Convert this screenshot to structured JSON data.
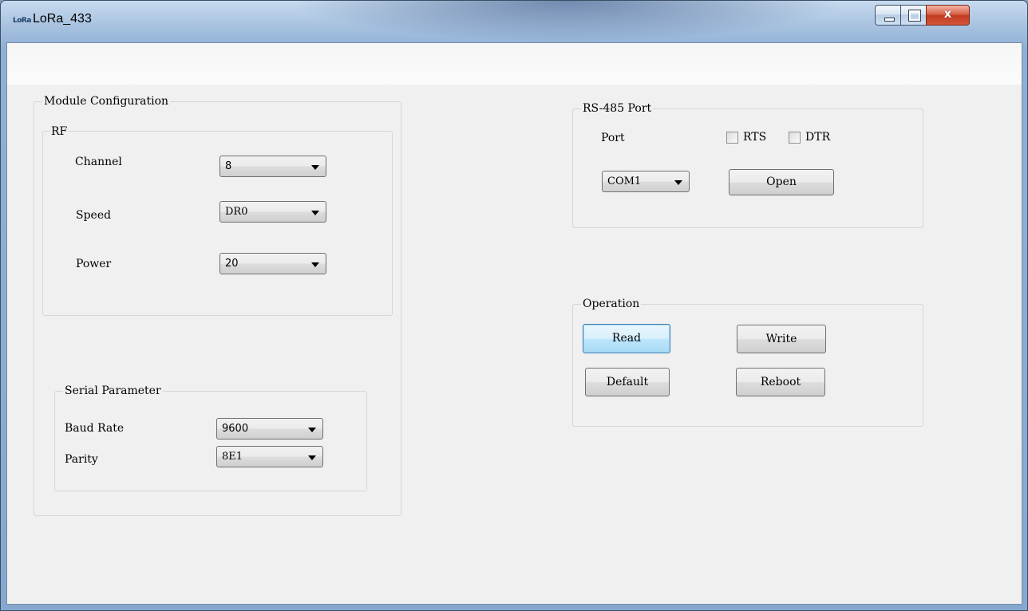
{
  "window": {
    "title": "LoRa_433",
    "icon_text": "LoRa",
    "icons": {
      "app": "lora-app-icon",
      "minimize": "minimize-icon",
      "maximize": "maximize-icon",
      "close": "close-icon"
    },
    "close_glyph": "x"
  },
  "module_config": {
    "legend": "Module Configuration",
    "rf": {
      "legend": "RF",
      "channel": {
        "label": "Channel",
        "value": "8"
      },
      "speed": {
        "label": "Speed",
        "value": "DR0"
      },
      "power": {
        "label": "Power",
        "value": "20"
      }
    },
    "serial": {
      "legend": "Serial Parameter",
      "baud_rate": {
        "label": "Baud Rate",
        "value": "9600"
      },
      "parity": {
        "label": "Parity",
        "value": "8E1"
      }
    }
  },
  "rs485": {
    "legend": "RS-485 Port",
    "port_label": "Port",
    "rts_label": "RTS",
    "dtr_label": "DTR",
    "rts_checked": false,
    "dtr_checked": false,
    "port_value": "COM1",
    "open_label": "Open"
  },
  "operation": {
    "legend": "Operation",
    "read_label": "Read",
    "write_label": "Write",
    "default_label": "Default",
    "reboot_label": "Reboot"
  },
  "colors": {
    "focus_border": "#3c7fb1",
    "close_button": "#c33b22",
    "client_bg": "#f0f0f0"
  }
}
